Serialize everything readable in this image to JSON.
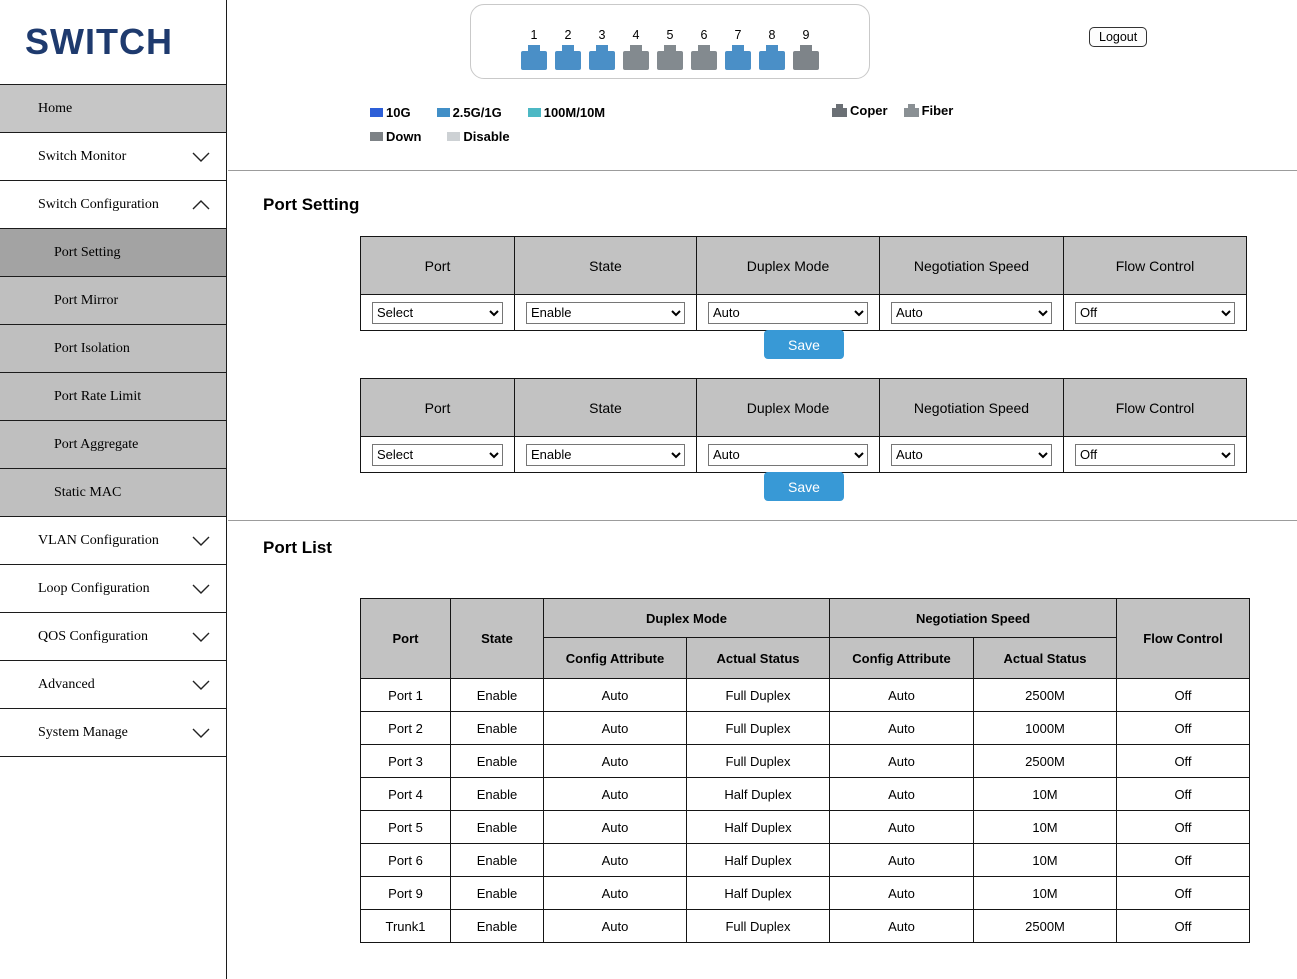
{
  "app": {
    "logo": "SWITCH",
    "logout_label": "Logout"
  },
  "colors": {
    "accent": "#3899d6",
    "port_up": "#4a8fc7",
    "port_down": "#838a8f"
  },
  "ports_panel": {
    "ports": [
      {
        "num": "1",
        "color": "#4a8fc7"
      },
      {
        "num": "2",
        "color": "#4a8fc7"
      },
      {
        "num": "3",
        "color": "#4a8fc7"
      },
      {
        "num": "4",
        "color": "#838a8f"
      },
      {
        "num": "5",
        "color": "#838a8f"
      },
      {
        "num": "6",
        "color": "#838a8f"
      },
      {
        "num": "7",
        "color": "#4a8fc7"
      },
      {
        "num": "8",
        "color": "#4a8fc7"
      },
      {
        "num": "9",
        "color": "#7e8489"
      }
    ]
  },
  "legend": {
    "speed": [
      {
        "label": "10G",
        "color": "#2d5fd8"
      },
      {
        "label": "2.5G/1G",
        "color": "#418fc7"
      },
      {
        "label": "100M/10M",
        "color": "#4cb8c4"
      }
    ],
    "state": [
      {
        "label": "Down",
        "color": "#7d8286"
      },
      {
        "label": "Disable",
        "color": "#cdd1d4"
      }
    ],
    "media": [
      {
        "label": "Coper",
        "color": "#6b7075"
      },
      {
        "label": "Fiber",
        "color": "#8a9094"
      }
    ]
  },
  "sidebar": {
    "items": [
      {
        "label": "Home"
      },
      {
        "label": "Switch Monitor",
        "chevron": "down"
      },
      {
        "label": "Switch Configuration",
        "chevron": "up"
      },
      {
        "label": "Port Setting",
        "selected": true
      },
      {
        "label": "Port Mirror"
      },
      {
        "label": "Port Isolation"
      },
      {
        "label": "Port Rate Limit"
      },
      {
        "label": "Port Aggregate"
      },
      {
        "label": "Static MAC"
      },
      {
        "label": "VLAN Configuration",
        "chevron": "down"
      },
      {
        "label": "Loop Configuration",
        "chevron": "down"
      },
      {
        "label": "QOS Configuration",
        "chevron": "down"
      },
      {
        "label": "Advanced",
        "chevron": "down"
      },
      {
        "label": "System Manage",
        "chevron": "down"
      }
    ]
  },
  "port_setting": {
    "title": "Port Setting",
    "columns": [
      "Port",
      "State",
      "Duplex Mode",
      "Negotiation Speed",
      "Flow Control"
    ],
    "controls": {
      "port": "Select",
      "state": "Enable",
      "duplex": "Auto",
      "speed": "Auto",
      "flow": "Off"
    },
    "save_label": "Save"
  },
  "port_list": {
    "title": "Port List",
    "header": {
      "port": "Port",
      "state": "State",
      "duplex": "Duplex Mode",
      "speed": "Negotiation Speed",
      "flow": "Flow Control",
      "config_attribute": "Config Attribute",
      "actual_status": "Actual Status"
    },
    "rows": [
      [
        "Port 1",
        "Enable",
        "Auto",
        "Full Duplex",
        "Auto",
        "2500M",
        "Off"
      ],
      [
        "Port 2",
        "Enable",
        "Auto",
        "Full Duplex",
        "Auto",
        "1000M",
        "Off"
      ],
      [
        "Port 3",
        "Enable",
        "Auto",
        "Full Duplex",
        "Auto",
        "2500M",
        "Off"
      ],
      [
        "Port 4",
        "Enable",
        "Auto",
        "Half Duplex",
        "Auto",
        "10M",
        "Off"
      ],
      [
        "Port 5",
        "Enable",
        "Auto",
        "Half Duplex",
        "Auto",
        "10M",
        "Off"
      ],
      [
        "Port 6",
        "Enable",
        "Auto",
        "Half Duplex",
        "Auto",
        "10M",
        "Off"
      ],
      [
        "Port 9",
        "Enable",
        "Auto",
        "Half Duplex",
        "Auto",
        "10M",
        "Off"
      ],
      [
        "Trunk1",
        "Enable",
        "Auto",
        "Full Duplex",
        "Auto",
        "2500M",
        "Off"
      ]
    ]
  }
}
